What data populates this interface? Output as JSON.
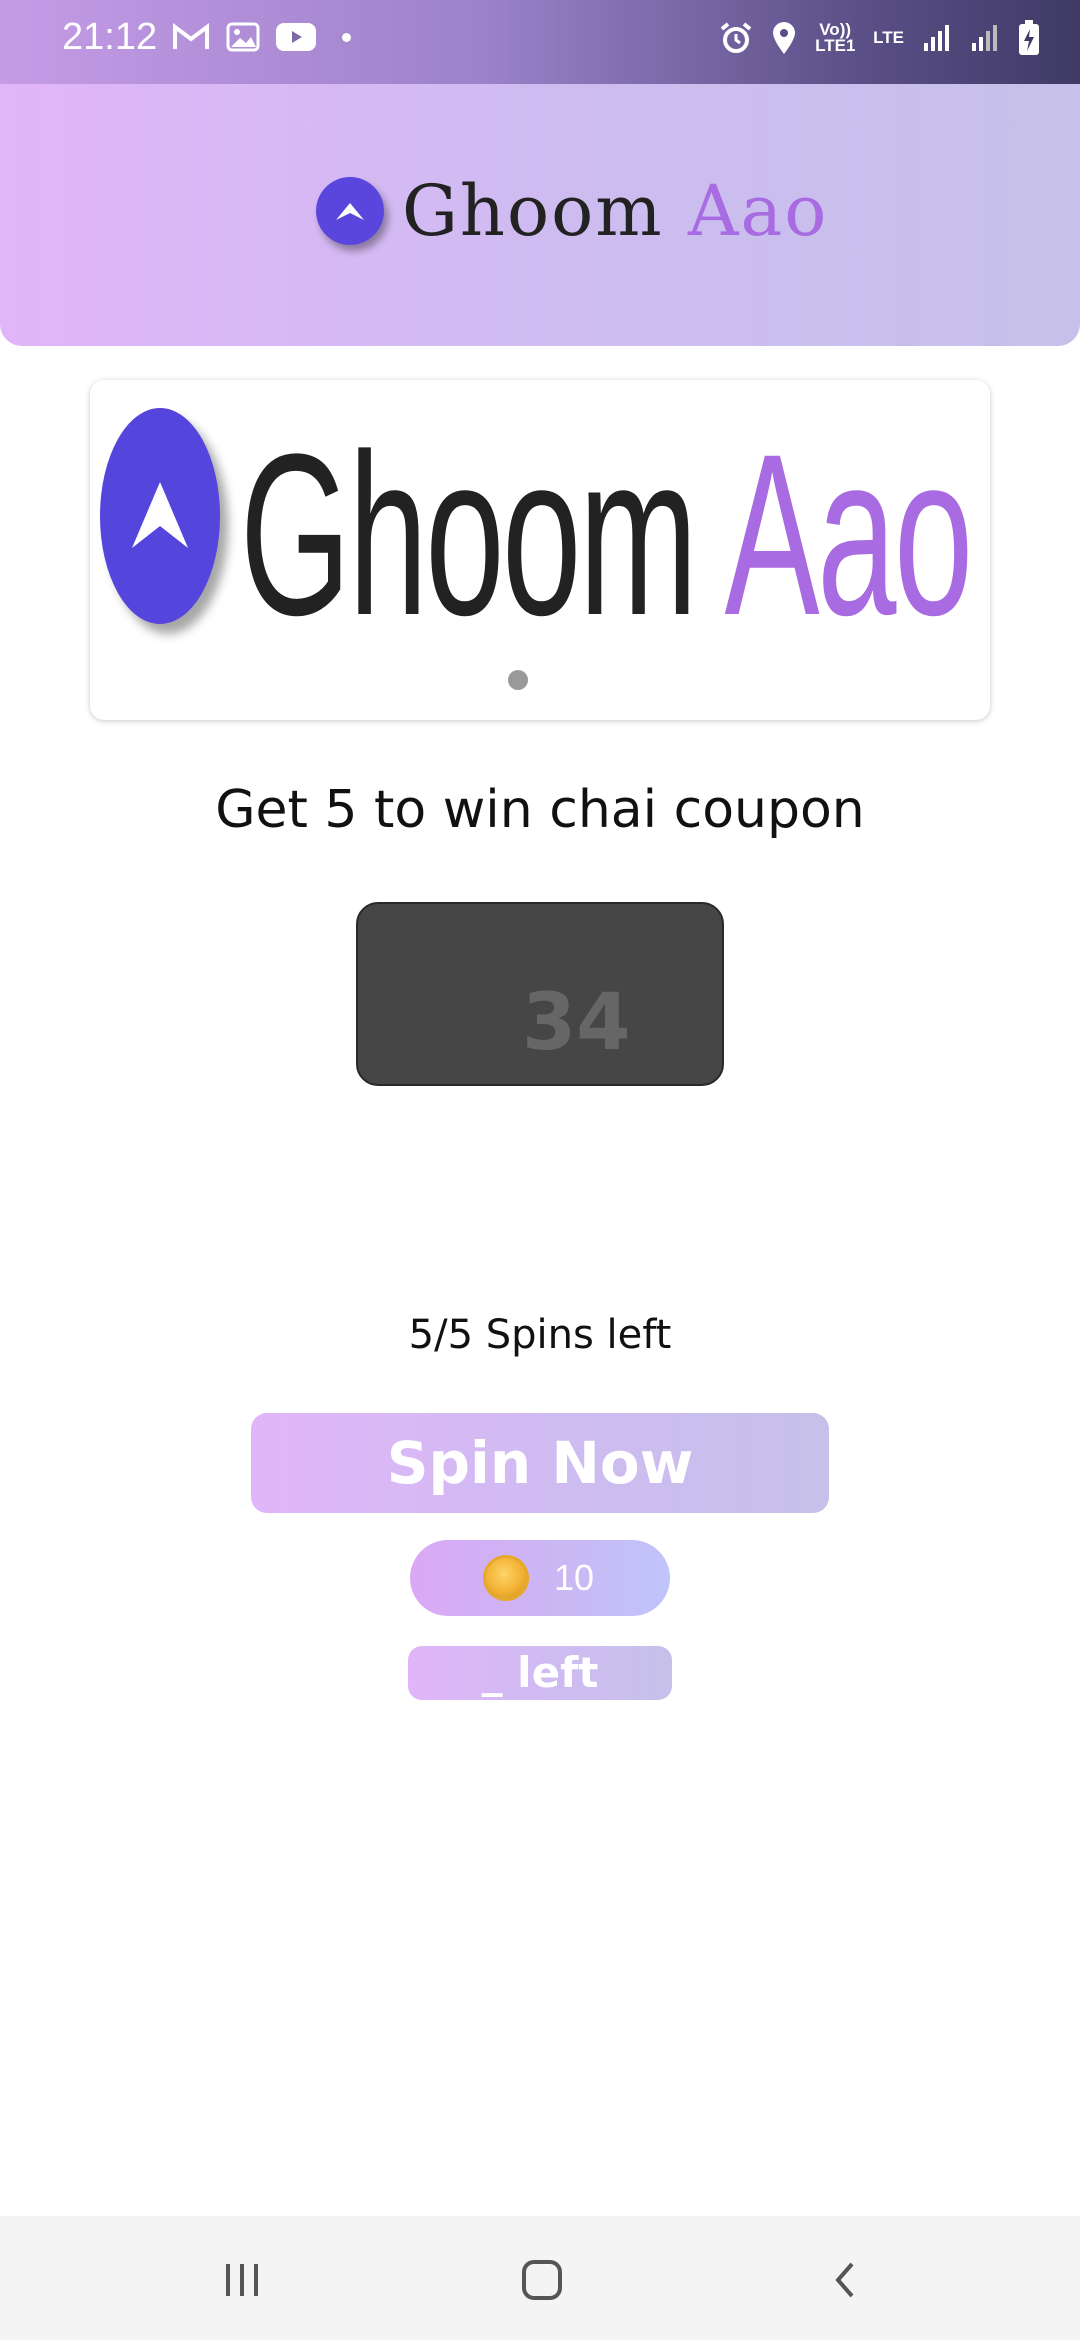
{
  "status_bar": {
    "time": "21:12",
    "left_icons": [
      "gmail-icon",
      "gallery-icon",
      "youtube-icon",
      "dot-icon"
    ],
    "right_icons": [
      "alarm-icon",
      "location-icon",
      "volte-icon",
      "lte-icon",
      "signal-icon",
      "signal-icon",
      "battery-charging-icon"
    ],
    "volte_label": "Vo)) LTE1",
    "lte_label": "LTE"
  },
  "header": {
    "logo_icon": "navigation-arrow-icon",
    "title_part1": "Ghoom",
    "title_part2": "Aao"
  },
  "banner": {
    "title_part1": "Ghoom",
    "title_part2": "Aao",
    "page_indicator": "1 of 1"
  },
  "game": {
    "prompt": "Get 5 to win chai coupon",
    "current_number": "34",
    "spins_left": "5/5 Spins left",
    "spin_button_label": "Spin Now",
    "coin_count": "10",
    "left_label": "_ left"
  },
  "nav": {
    "recents_icon": "recents-icon",
    "home_icon": "home-icon",
    "back_icon": "back-icon"
  },
  "colors": {
    "brand_blue": "#5a46dc",
    "brand_purple": "#a86be2",
    "gradient_start": "#e1b5f9",
    "gradient_end": "#c6c0ea"
  }
}
